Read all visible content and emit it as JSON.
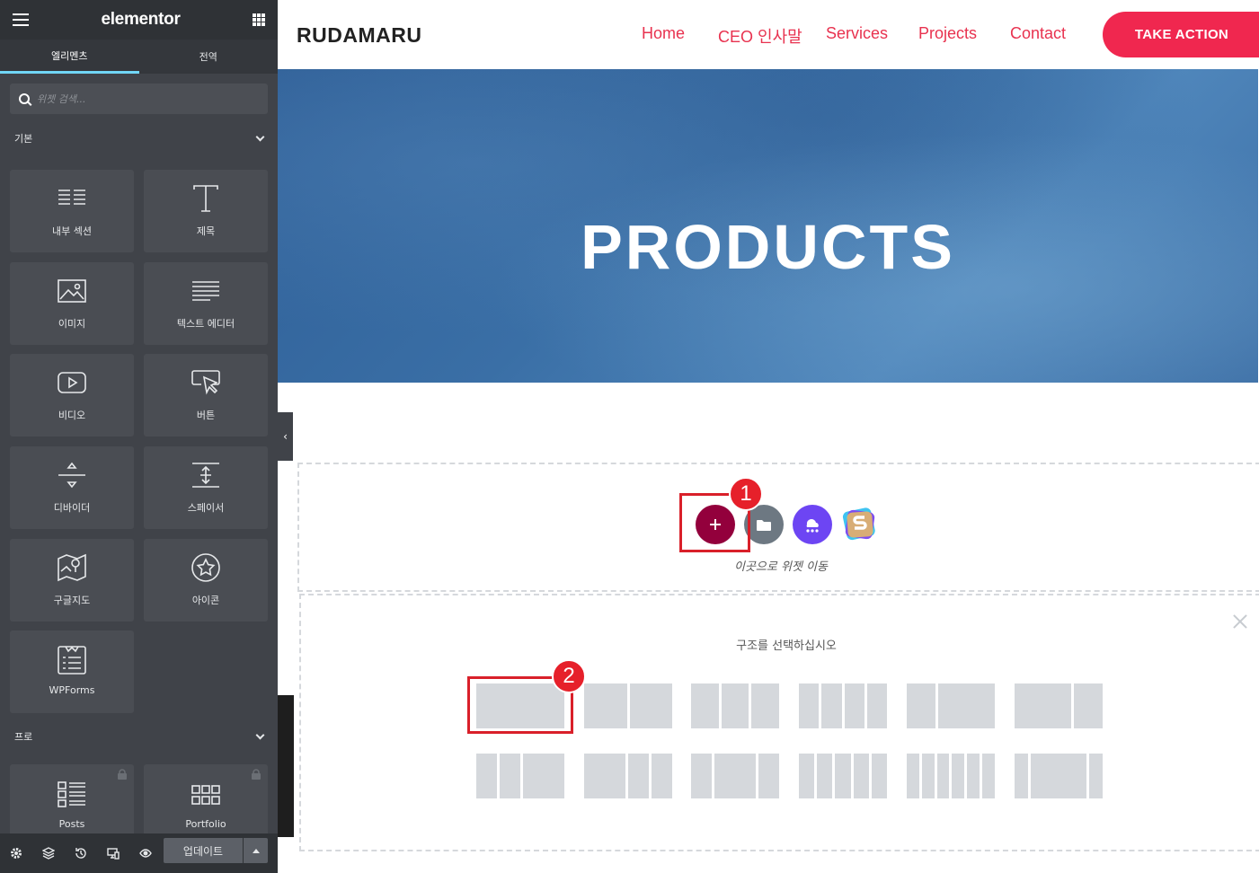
{
  "sidebar": {
    "brand": "elementor",
    "tabs": [
      {
        "label": "엘리멘츠",
        "active": true
      },
      {
        "label": "전역",
        "active": false
      }
    ],
    "search_placeholder": "위젯 검색...",
    "categories": {
      "basic": "기본",
      "pro": "프로"
    },
    "widgets": [
      {
        "label": "내부 섹션",
        "icon": "inner-section-icon"
      },
      {
        "label": "제목",
        "icon": "heading-icon"
      },
      {
        "label": "이미지",
        "icon": "image-icon"
      },
      {
        "label": "텍스트 에디터",
        "icon": "text-editor-icon"
      },
      {
        "label": "비디오",
        "icon": "video-icon"
      },
      {
        "label": "버튼",
        "icon": "button-icon"
      },
      {
        "label": "디바이더",
        "icon": "divider-icon"
      },
      {
        "label": "스페이서",
        "icon": "spacer-icon"
      },
      {
        "label": "구글지도",
        "icon": "google-maps-icon"
      },
      {
        "label": "아이콘",
        "icon": "star-icon"
      },
      {
        "label": "WPForms",
        "icon": "wpforms-icon"
      }
    ],
    "pro_widgets": [
      {
        "label": "Posts",
        "icon": "posts-icon",
        "locked": true
      },
      {
        "label": "Portfolio",
        "icon": "portfolio-icon",
        "locked": true
      }
    ],
    "footer": {
      "update_label": "업데이트",
      "icons": [
        "settings-icon",
        "layers-icon",
        "history-icon",
        "responsive-icon",
        "preview-eye-icon"
      ]
    }
  },
  "site": {
    "logo": "RUDAMARU",
    "nav": [
      "Home",
      "CEO 인사말",
      "Services",
      "Projects",
      "Contact"
    ],
    "cta": "TAKE ACTION",
    "hero_title": "PRODUCTS"
  },
  "editor": {
    "drop_text": "이곳으로 위젯 이동",
    "structure_title": "구조를 선택하십시오",
    "add_buttons": [
      "add-section-plus-icon",
      "template-folder-icon",
      "cloud-template-icon",
      "starter-templates-icon"
    ],
    "annotations": [
      "1",
      "2"
    ]
  },
  "colors": {
    "sidebar_bg": "#404349",
    "accent_tab": "#71d7f7",
    "nav_link": "#e8324f",
    "cta_bg": "#f0274f",
    "add_button": "#93003c",
    "highlight": "#d9202a"
  }
}
